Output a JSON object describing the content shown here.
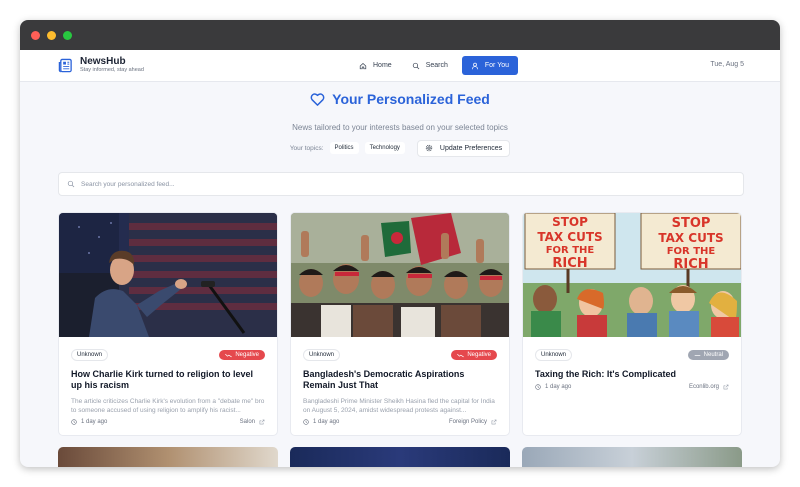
{
  "window": {
    "controls": [
      "close",
      "minimize",
      "maximize"
    ]
  },
  "brand": {
    "name": "NewsHub",
    "tagline": "Stay informed, stay ahead",
    "icon": "newspaper-icon"
  },
  "nav": {
    "items": [
      {
        "label": "Home",
        "icon": "home-icon",
        "active": false
      },
      {
        "label": "Search",
        "icon": "search-icon",
        "active": false
      },
      {
        "label": "For You",
        "icon": "user-icon",
        "active": true
      }
    ],
    "date": "Tue, Aug 5"
  },
  "hero": {
    "title": "Your Personalized Feed",
    "icon": "heart-icon",
    "subtitle": "News tailored to your interests based on your selected topics",
    "topics_label": "Your topics:",
    "topics": [
      "Politics",
      "Technology"
    ],
    "update_button": "Update Preferences"
  },
  "search": {
    "placeholder": "Search your personalized feed..."
  },
  "articles": [
    {
      "source_chip": "Unknown",
      "sentiment": "Negative",
      "title": "How Charlie Kirk turned to religion to level up his racism",
      "summary": "The article criticizes Charlie Kirk's evolution from a \"debate me\" bro to someone accused of using religion to amplify his racist...",
      "time": "1 day ago",
      "publisher": "Salon"
    },
    {
      "source_chip": "Unknown",
      "sentiment": "Negative",
      "title": "Bangladesh's Democratic Aspirations Remain Just That",
      "summary": "Bangladeshi Prime Minister Sheikh Hasina fled the capital for India on August 5, 2024, amidst widespread protests against...",
      "time": "1 day ago",
      "publisher": "Foreign Policy"
    },
    {
      "source_chip": "Unknown",
      "sentiment": "Neutral",
      "title": "Taxing the Rich: It's Complicated",
      "summary": "",
      "time": "1 day ago",
      "publisher": "Econlib.org",
      "image_text": [
        "STOP",
        "TAX CUTS",
        "FOR THE",
        "RICH"
      ]
    }
  ],
  "colors": {
    "accent": "#2b63d9",
    "negative": "#e5484d",
    "neutral": "#a0a6b2"
  }
}
